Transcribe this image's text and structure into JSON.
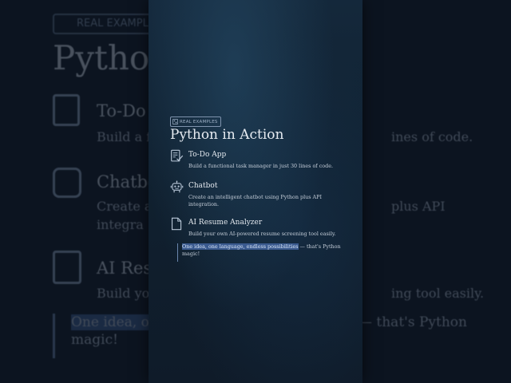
{
  "badge_label": "REAL EXAMPLES",
  "title": "Python in Action",
  "items": [
    {
      "title": "To-Do App",
      "description": "Build a functional task manager in just 30 lines of code.",
      "icon": "checklist-icon"
    },
    {
      "title": "Chatbot",
      "description": "Create an intelligent chatbot using Python plus API integration.",
      "icon": "robot-icon"
    },
    {
      "title": "AI Resume Analyzer",
      "description": "Build your own AI-powered resume screening tool easily.",
      "icon": "document-icon"
    }
  ],
  "quote": {
    "highlight": "One idea, one language, endless possibilities",
    "rest": " — that's Python magic!"
  },
  "background": {
    "title_fragment": "Pytho",
    "item1_title_fragment": "To-Do",
    "item1_desc_fragment": "Build a f",
    "item1_desc_right": "ines of code.",
    "item2_title_fragment": "Chatbo",
    "item2_desc_fragment": "Create a",
    "item2_desc_right": "plus API",
    "item2_desc_line2": "integra",
    "item3_title_fragment": "AI Resu",
    "item3_desc_fragment": "Build yo",
    "item3_desc_right": "ing tool easily.",
    "quote_line1_left": "One idea, on",
    "quote_line1_right": "— that's Python",
    "quote_line2": "magic!"
  },
  "colors": {
    "background": "#0c1420",
    "card": "#14283b",
    "highlight": "#3a5a8f",
    "accent_border": "#6b86ad"
  }
}
